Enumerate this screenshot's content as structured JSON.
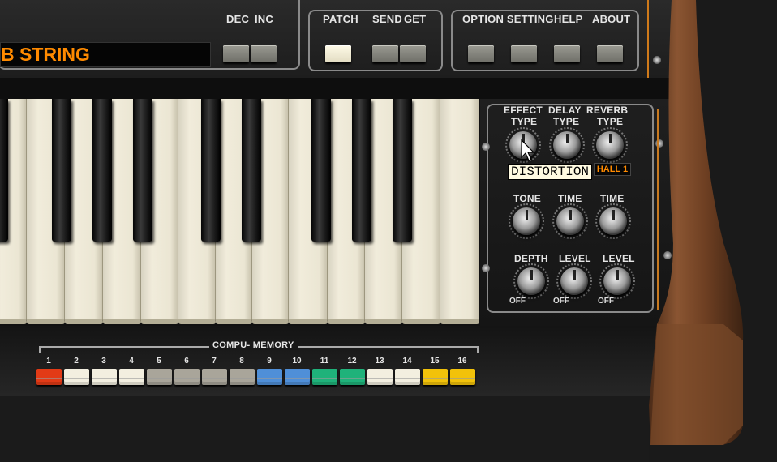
{
  "header": {
    "patch_name": "B STRING",
    "dec_label": "DEC",
    "inc_label": "INC",
    "patch_label": "PATCH",
    "send_label": "SEND",
    "get_label": "GET",
    "option_setting_label": "OPTION SETTING",
    "help_label": "HELP",
    "about_label": "ABOUT"
  },
  "effects": {
    "effect_label_1": "EFFECT",
    "effect_label_2": "TYPE",
    "delay_label_1": "DELAY",
    "delay_label_2": "TYPE",
    "reverb_label_1": "REVERB",
    "reverb_label_2": "TYPE",
    "tone_label": "TONE",
    "delay_time_label": "TIME",
    "reverb_time_label": "TIME",
    "depth_label": "DEPTH",
    "delay_level_label": "LEVEL",
    "reverb_level_label": "LEVEL",
    "off_1": "OFF",
    "off_2": "OFF",
    "off_3": "OFF",
    "reverb_type_value": "HALL 1",
    "tooltip": "DISTORTION"
  },
  "memory": {
    "title": "COMPU- MEMORY",
    "buttons": [
      {
        "label": "1",
        "color": "#e23a16"
      },
      {
        "label": "2",
        "color": "#f3efe0"
      },
      {
        "label": "3",
        "color": "#f3efe0"
      },
      {
        "label": "4",
        "color": "#f3efe0"
      },
      {
        "label": "5",
        "color": "#a9a59a"
      },
      {
        "label": "6",
        "color": "#a9a59a"
      },
      {
        "label": "7",
        "color": "#a9a59a"
      },
      {
        "label": "8",
        "color": "#a9a59a"
      },
      {
        "label": "9",
        "color": "#4f8fd8"
      },
      {
        "label": "10",
        "color": "#4f8fd8"
      },
      {
        "label": "11",
        "color": "#1fb27a"
      },
      {
        "label": "12",
        "color": "#1fb27a"
      },
      {
        "label": "13",
        "color": "#f3efe0"
      },
      {
        "label": "14",
        "color": "#f3efe0"
      },
      {
        "label": "15",
        "color": "#f2c20a"
      },
      {
        "label": "16",
        "color": "#f2c20a"
      }
    ]
  },
  "colors": {
    "accent": "#ff8a00",
    "wood": "#7a4a2a"
  }
}
